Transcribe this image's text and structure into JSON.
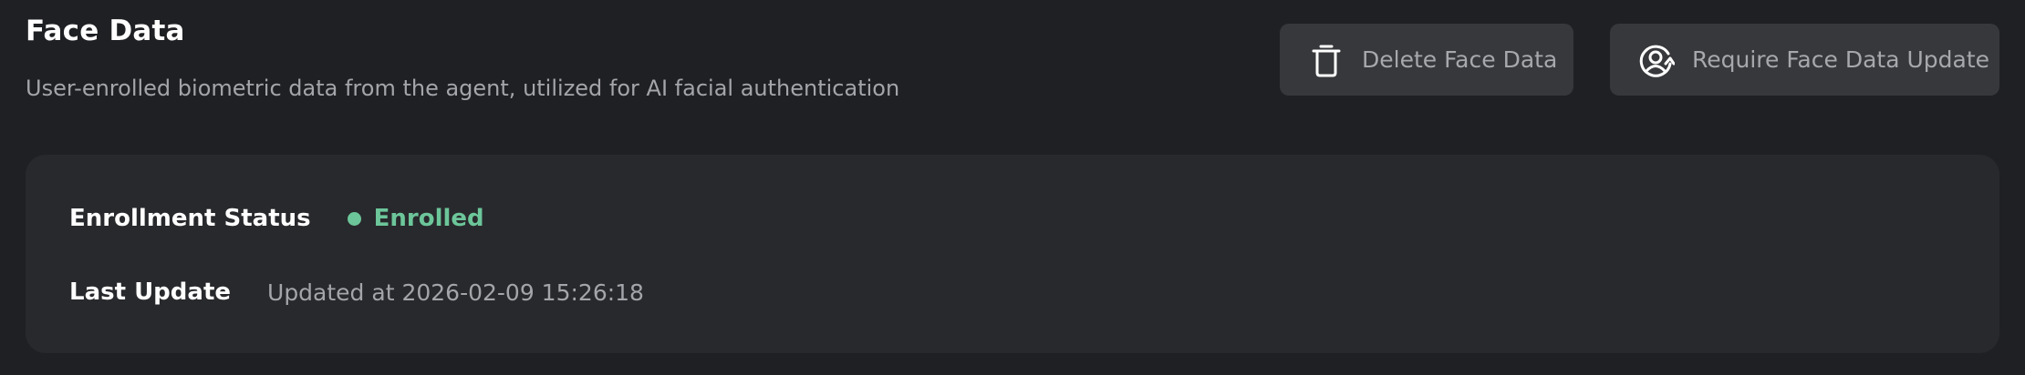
{
  "header": {
    "title": "Face Data",
    "subtitle": "User-enrolled biometric data from the agent, utilized for AI facial authentication"
  },
  "actions": {
    "delete": {
      "label": "Delete Face Data",
      "icon": "trash-icon"
    },
    "require_update": {
      "label": "Require Face Data Update",
      "icon": "face-refresh-icon"
    }
  },
  "card": {
    "enrollment": {
      "label": "Enrollment Status",
      "value": "Enrolled",
      "status_color": "#6cc69a"
    },
    "last_update": {
      "label": "Last Update",
      "value": "Updated at 2026-02-09 15:26:18"
    }
  },
  "colors": {
    "background": "#1f2023",
    "card": "#28292c",
    "button": "#37383b",
    "muted_text": "#a3a5aa"
  }
}
